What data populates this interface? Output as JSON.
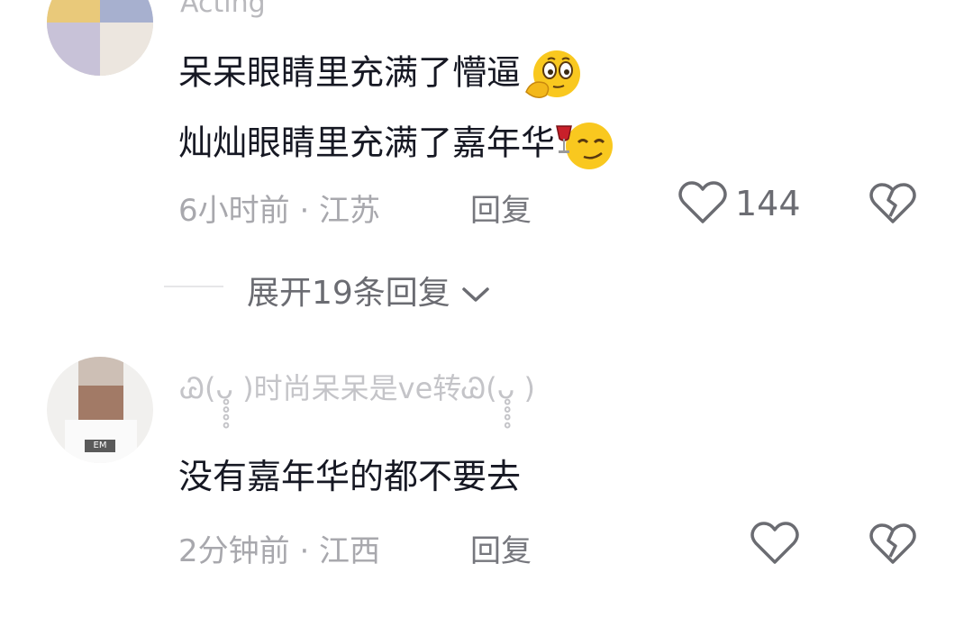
{
  "comments": [
    {
      "username": "Acting",
      "lines": [
        "呆呆眼睛里充满了懵逼",
        "灿灿眼睛里充满了嘉年华"
      ],
      "emojis": [
        "thinking-emoji",
        "wine-smirk-emoji"
      ],
      "time_location": "6小时前 · 江苏",
      "reply_label": "回复",
      "likes": "144"
    },
    {
      "username": "Ꮚ(ᴗ̥̥̥̥ )时尚呆呆是ve转Ꮚ(ᴗ̥̥̥̥ )",
      "lines": [
        "没有嘉年华的都不要去"
      ],
      "time_location": "2分钟前 · 江西",
      "reply_label": "回复",
      "likes": ""
    }
  ],
  "expand_replies": "展开19条回复",
  "colors": {
    "text_primary": "#161823",
    "text_meta": "#a8a8ad",
    "icon": "#6b6c72"
  }
}
